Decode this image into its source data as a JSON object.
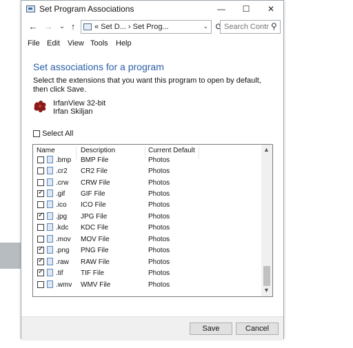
{
  "window": {
    "title": "Set Program Associations",
    "minimize": "—",
    "maximize": "☐",
    "close": "✕"
  },
  "nav": {
    "back": "←",
    "forward": "→",
    "recent": "⌄",
    "up": "↑",
    "address": "« Set D... › Set Prog...",
    "refresh": "⟳",
    "search_placeholder": "Search Contr...",
    "search_icon": "⚲"
  },
  "menu": [
    "File",
    "Edit",
    "View",
    "Tools",
    "Help"
  ],
  "heading": "Set associations for a program",
  "description": "Select the extensions that you want this program to open by default, then click Save.",
  "program": {
    "name": "IrfanView 32-bit",
    "publisher": "Irfan Skiljan"
  },
  "select_all": "Select All",
  "columns": {
    "name": "Name",
    "description": "Description",
    "default": "Current Default"
  },
  "rows": [
    {
      "ext": ".bmp",
      "desc": "BMP File",
      "def": "Photos",
      "checked": false
    },
    {
      "ext": ".cr2",
      "desc": "CR2 File",
      "def": "Photos",
      "checked": false
    },
    {
      "ext": ".crw",
      "desc": "CRW File",
      "def": "Photos",
      "checked": false
    },
    {
      "ext": ".gif",
      "desc": "GIF File",
      "def": "Photos",
      "checked": true
    },
    {
      "ext": ".ico",
      "desc": "ICO File",
      "def": "Photos",
      "checked": false
    },
    {
      "ext": ".jpg",
      "desc": "JPG File",
      "def": "Photos",
      "checked": true
    },
    {
      "ext": ".kdc",
      "desc": "KDC File",
      "def": "Photos",
      "checked": false
    },
    {
      "ext": ".mov",
      "desc": "MOV File",
      "def": "Photos",
      "checked": false
    },
    {
      "ext": ".png",
      "desc": "PNG File",
      "def": "Photos",
      "checked": true
    },
    {
      "ext": ".raw",
      "desc": "RAW File",
      "def": "Photos",
      "checked": true
    },
    {
      "ext": ".tif",
      "desc": "TIF File",
      "def": "Photos",
      "checked": true
    },
    {
      "ext": ".wmv",
      "desc": "WMV File",
      "def": "Photos",
      "checked": false
    }
  ],
  "buttons": {
    "save": "Save",
    "cancel": "Cancel"
  }
}
